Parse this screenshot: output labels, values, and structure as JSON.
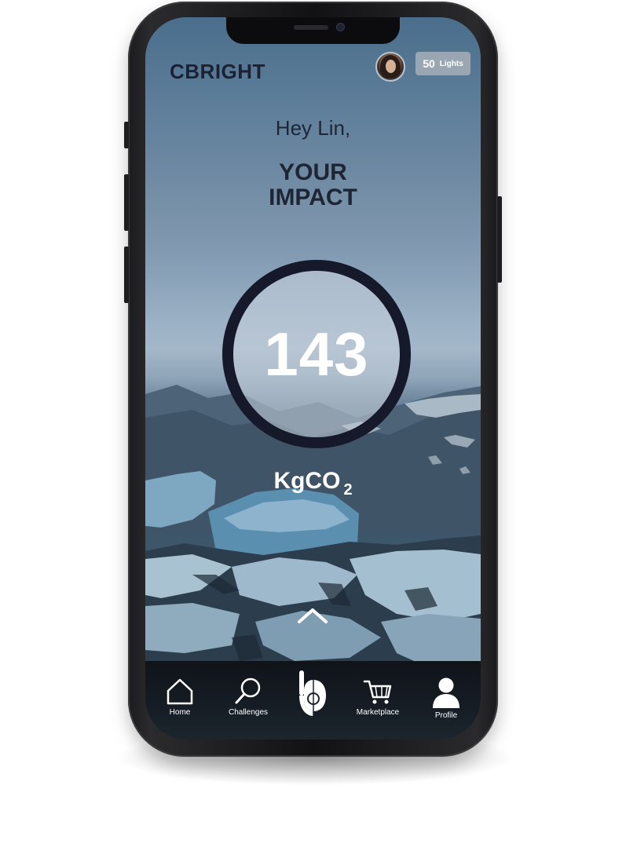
{
  "app": {
    "brand": "CBRIGHT"
  },
  "header": {
    "lights": {
      "count": "50",
      "label": "Lights"
    }
  },
  "main": {
    "greeting": "Hey Lin,",
    "title_line1": "YOUR",
    "title_line2": "IMPACT",
    "impact_value": "143",
    "unit_main": "KgCO",
    "unit_sub": "2"
  },
  "nav": {
    "items": [
      {
        "label": "Home",
        "icon": "home-icon"
      },
      {
        "label": "Challenges",
        "icon": "search-icon"
      },
      {
        "label": "",
        "icon": "cbright-logo-icon"
      },
      {
        "label": "Marketplace",
        "icon": "cart-icon"
      },
      {
        "label": "Profile",
        "icon": "user-icon"
      }
    ]
  },
  "colors": {
    "ring": "#15192a",
    "badge": "#9aa6b2",
    "text_dark": "#1e2534"
  }
}
